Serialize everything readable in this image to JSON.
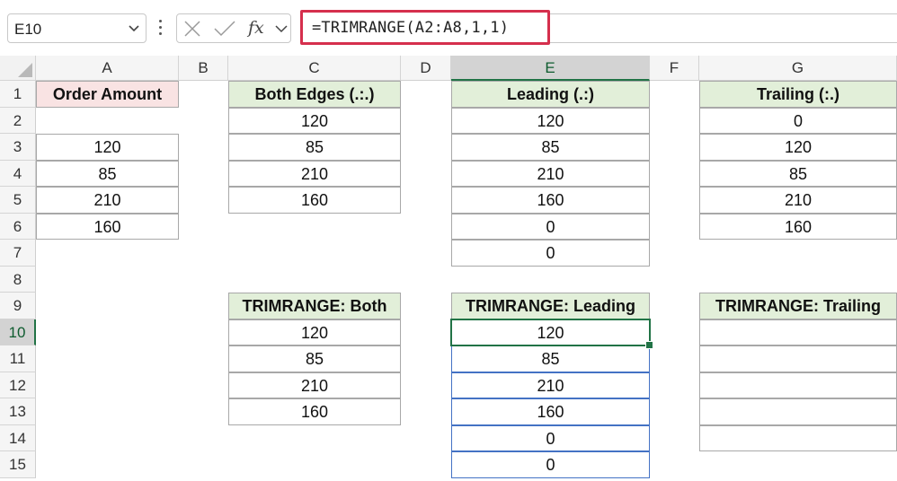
{
  "name_box": {
    "value": "E10"
  },
  "formula_bar": {
    "formula": "=TRIMRANGE(A2:A8,1,1)",
    "fx_label": "fx"
  },
  "columns": [
    "A",
    "B",
    "C",
    "D",
    "E",
    "F",
    "G"
  ],
  "selected_column": "E",
  "rows": [
    "1",
    "2",
    "3",
    "4",
    "5",
    "6",
    "7",
    "8",
    "9",
    "10",
    "11",
    "12",
    "13",
    "14",
    "15"
  ],
  "selected_row": "10",
  "cells": {
    "A": {
      "header": "Order Amount",
      "values": [
        "",
        "120",
        "85",
        "210",
        "160"
      ]
    },
    "C_top": {
      "header": "Both Edges (.:.)",
      "values": [
        "120",
        "85",
        "210",
        "160"
      ]
    },
    "E_top": {
      "header": "Leading (.:)",
      "values": [
        "120",
        "85",
        "210",
        "160",
        "0",
        "0"
      ]
    },
    "G_top": {
      "header": "Trailing (:.)",
      "values": [
        "0",
        "120",
        "85",
        "210",
        "160"
      ]
    },
    "C_bottom": {
      "header": "TRIMRANGE: Both",
      "values": [
        "120",
        "85",
        "210",
        "160"
      ]
    },
    "E_bottom": {
      "header": "TRIMRANGE: Leading",
      "values": [
        "120",
        "85",
        "210",
        "160",
        "0",
        "0"
      ]
    },
    "G_bottom": {
      "header": "TRIMRANGE: Trailing",
      "values": [
        "",
        "",
        "",
        "",
        ""
      ]
    }
  },
  "colors": {
    "accent_green": "#217346",
    "header_green": "#e2efd9",
    "header_pink": "#f9e3e3",
    "formula_highlight": "#d52f4d"
  }
}
